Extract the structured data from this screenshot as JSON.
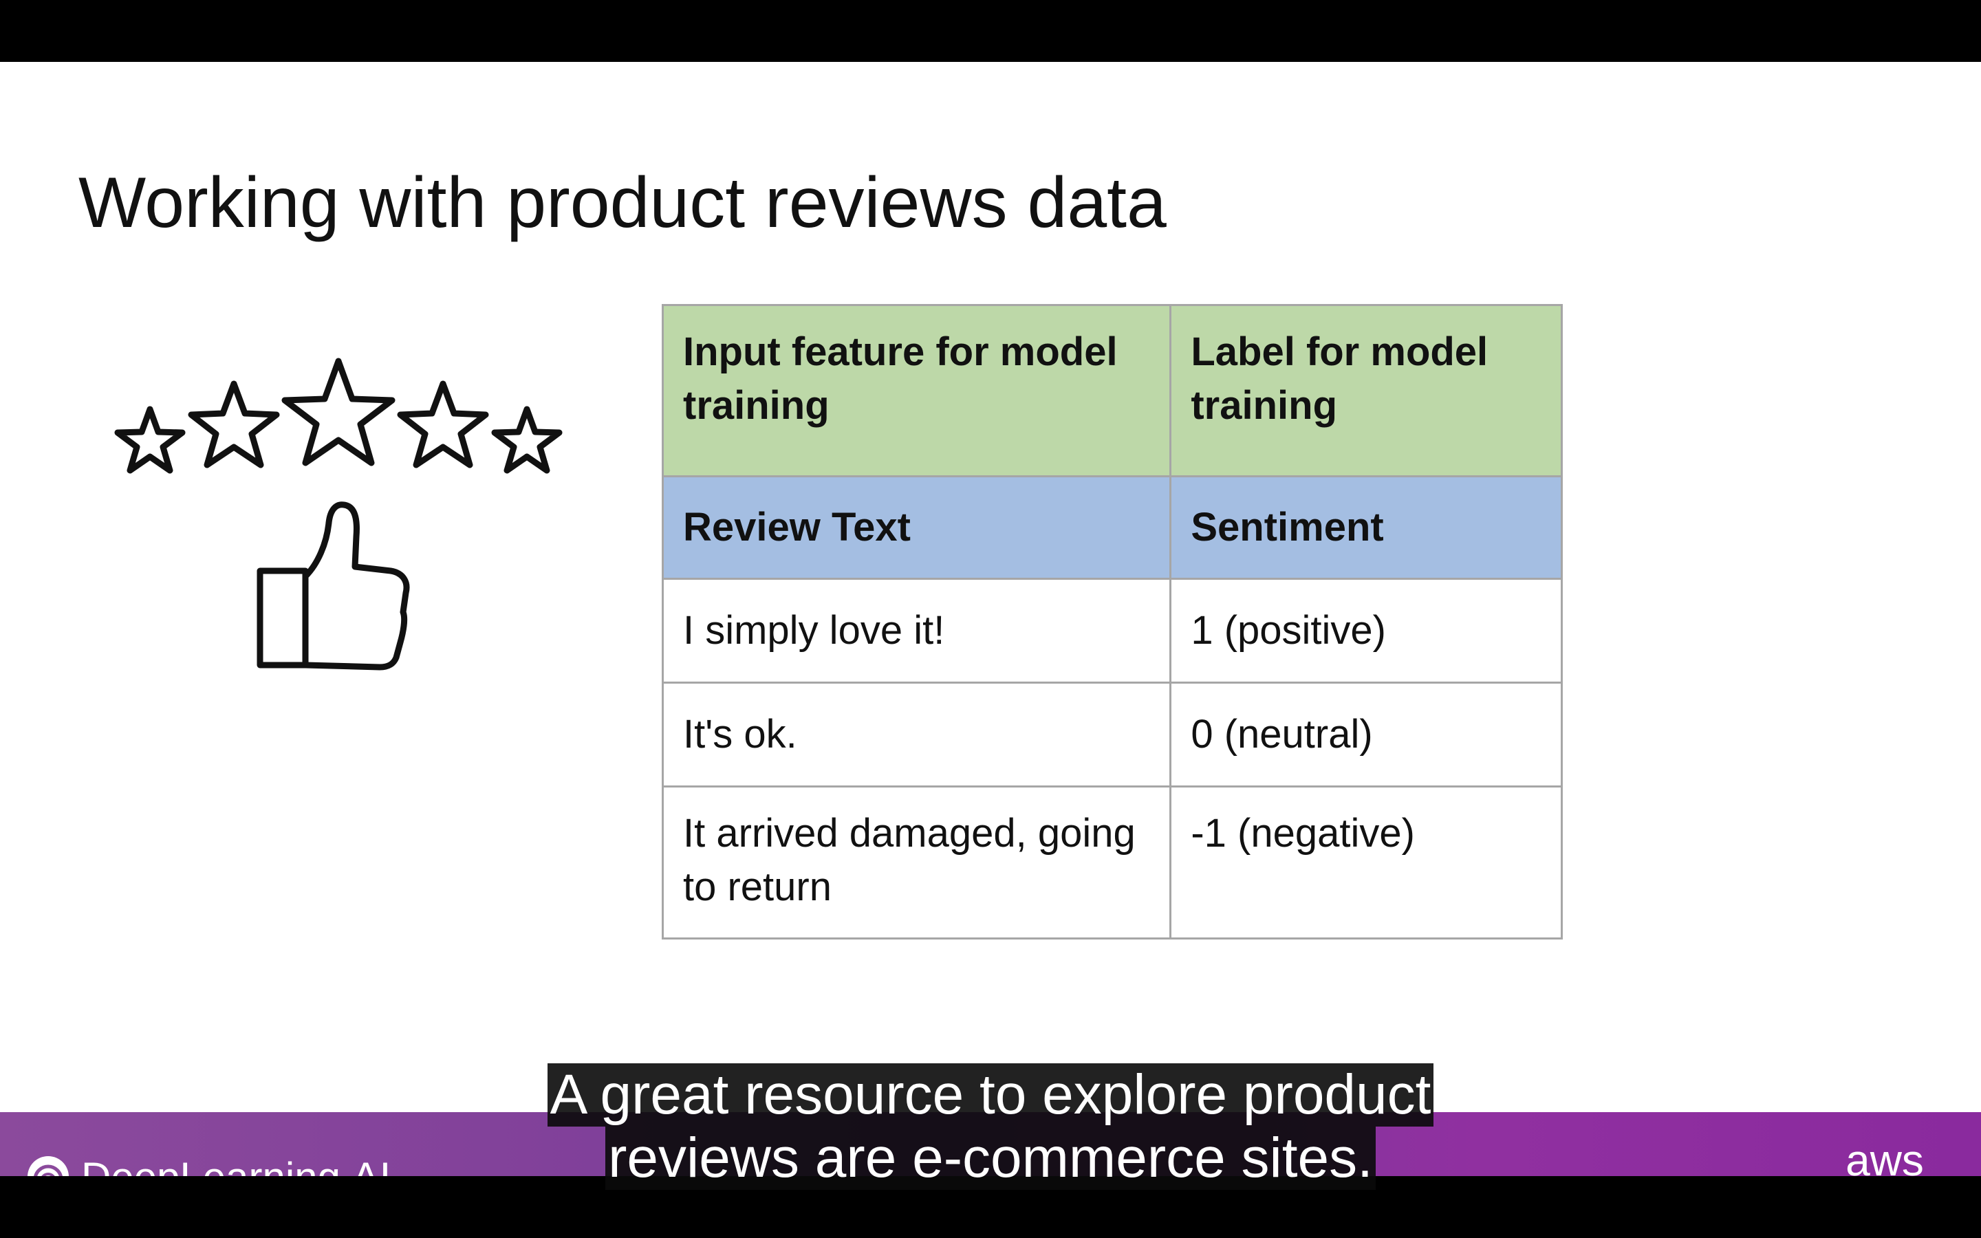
{
  "slide": {
    "title": "Working with product reviews data",
    "rating_stars": 5
  },
  "table": {
    "header": {
      "col1": "Input feature for model training",
      "col2": "Label for model training"
    },
    "feature_row": {
      "col1": "Review Text",
      "col2": "Sentiment"
    },
    "rows": [
      {
        "review": "I simply love it!",
        "sentiment": "1 (positive)"
      },
      {
        "review": "It's ok.",
        "sentiment": "0 (neutral)"
      },
      {
        "review": "It arrived damaged, going to return",
        "sentiment": "-1 (negative)"
      }
    ]
  },
  "footer": {
    "brand": "DeepLearning.AI",
    "partner": "aws"
  },
  "caption": {
    "line1": "A great resource to explore product",
    "line2": "reviews are e-commerce sites."
  },
  "colors": {
    "header_green": "#bdd8a8",
    "feature_blue": "#a4bee2",
    "footer_purple": "#7b3b99"
  }
}
